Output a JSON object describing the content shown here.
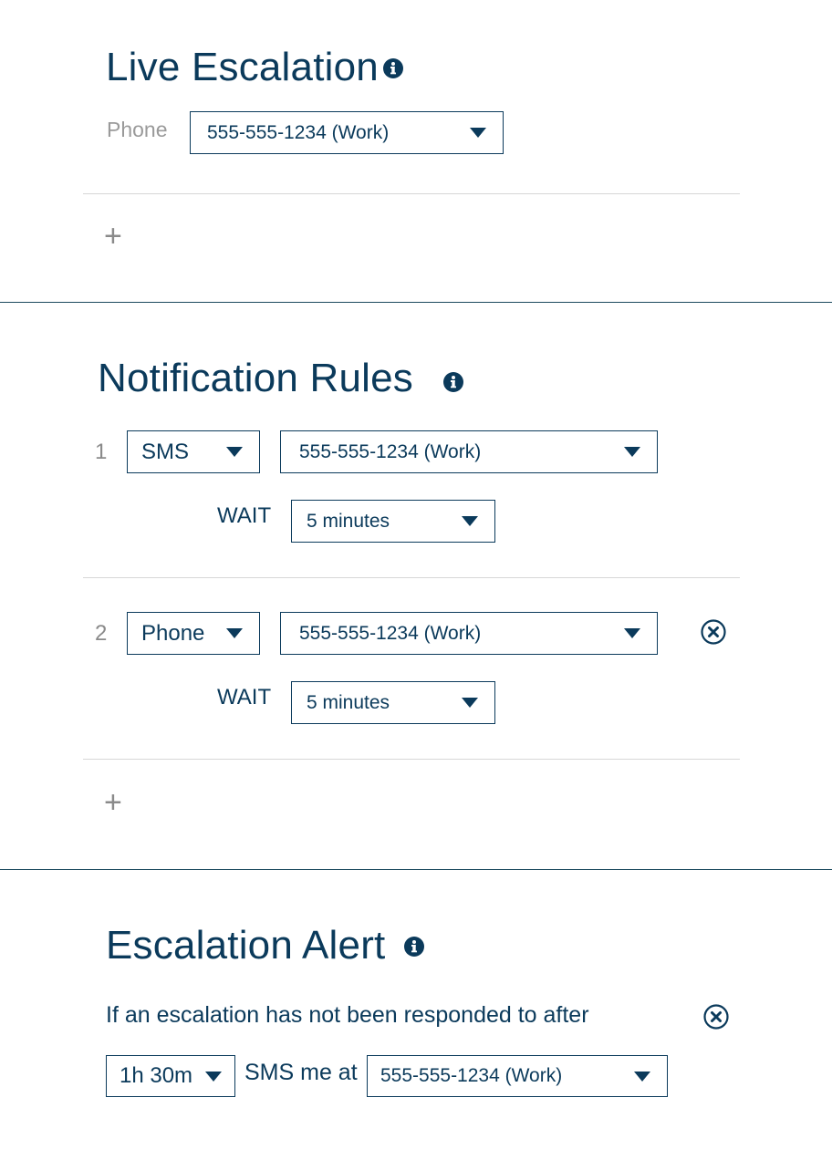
{
  "live_escalation": {
    "title": "Live Escalation",
    "phone_label": "Phone",
    "phone_value": "555-555-1234 (Work)",
    "add_label": "+"
  },
  "notification_rules": {
    "title": "Notification Rules",
    "rules": [
      {
        "number": "1",
        "method": "SMS",
        "contact": "555-555-1234 (Work)",
        "wait_label": "WAIT",
        "wait_value": "5 minutes"
      },
      {
        "number": "2",
        "method": "Phone",
        "contact": "555-555-1234 (Work)",
        "wait_label": "WAIT",
        "wait_value": "5 minutes"
      }
    ],
    "add_label": "+"
  },
  "escalation_alert": {
    "title": "Escalation Alert",
    "description": "If an escalation has not been responded to after",
    "duration_value": "1h 30m",
    "sms_label": "SMS me at",
    "contact_value": "555-555-1234 (Work)"
  },
  "icons": {
    "info": "info-icon",
    "remove": "remove-circle-icon",
    "dropdown": "caret-down-icon",
    "add": "plus-icon"
  },
  "colors": {
    "primary": "#0b3a5b",
    "muted": "#8a8a8a",
    "divider_light": "#d7d7d7",
    "divider_dark": "#1c4a5e"
  }
}
